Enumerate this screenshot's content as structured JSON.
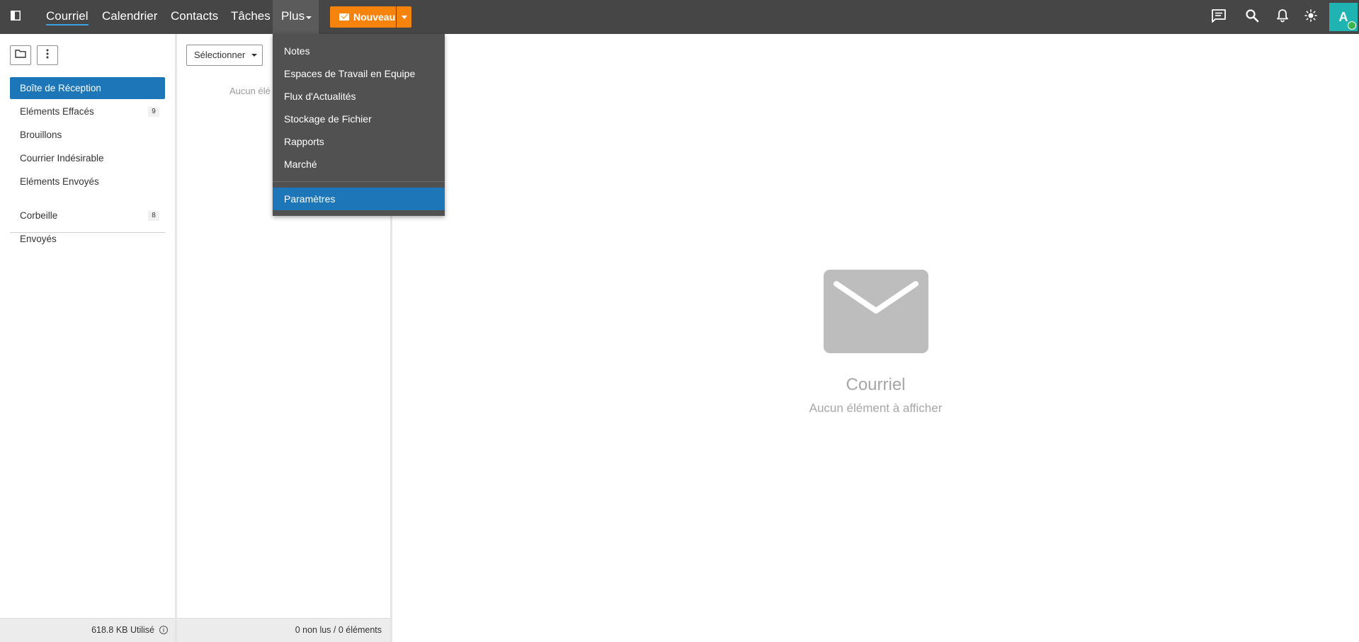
{
  "topbar": {
    "nav": [
      {
        "label": "Courriel",
        "active": true
      },
      {
        "label": "Calendrier",
        "active": false
      },
      {
        "label": "Contacts",
        "active": false
      },
      {
        "label": "Tâches",
        "active": false
      }
    ],
    "more_label": "Plus",
    "new_button_label": "Nouveau",
    "avatar_initial": "A",
    "icons": [
      "sidebar-toggle-icon",
      "chat-icon",
      "search-icon",
      "bell-icon",
      "sun-icon"
    ],
    "colors": {
      "bar": "#464646",
      "accent": "#f6840c",
      "avatar": "#1fb4b1",
      "selected": "#1c76b8",
      "online": "#3bb54a"
    }
  },
  "more_menu": {
    "items": [
      "Notes",
      "Espaces de Travail en Equipe",
      "Flux d'Actualités",
      "Stockage de Fichier",
      "Rapports",
      "Marché"
    ],
    "settings_label": "Paramètres"
  },
  "sidebar": {
    "folders": [
      {
        "label": "Boîte de Réception",
        "count": "",
        "selected": true
      },
      {
        "label": "Eléments Effacés",
        "count": "9",
        "selected": false
      },
      {
        "label": "Brouillons",
        "count": "",
        "selected": false
      },
      {
        "label": "Courrier Indésirable",
        "count": "",
        "selected": false
      },
      {
        "label": "Eléments Envoyés",
        "count": "",
        "selected": false
      }
    ],
    "extra_folders": [
      {
        "label": "Corbeille",
        "count": "8"
      },
      {
        "label": "Envoyés",
        "count": ""
      }
    ],
    "storage_label": "618.8 KB Utilisé"
  },
  "list": {
    "select_label": "Sélectionner",
    "empty_text": "Aucun élé",
    "footer_label": "0 non lus / 0 éléments"
  },
  "main": {
    "title": "Courriel",
    "subtitle": "Aucun élément à afficher"
  }
}
